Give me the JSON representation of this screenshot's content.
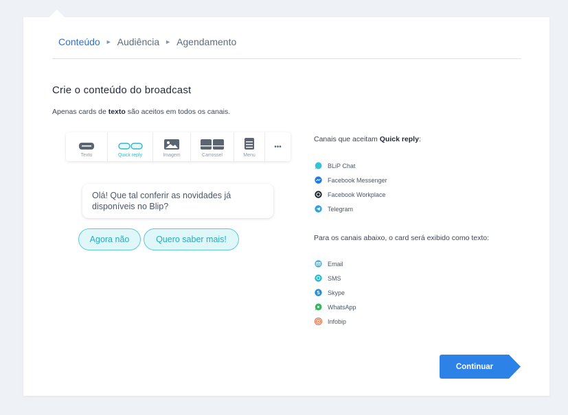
{
  "breadcrumb": {
    "steps": [
      "Conteúdo",
      "Audiência",
      "Agendamento"
    ]
  },
  "content": {
    "title": "Crie o conteúdo do broadcast",
    "subtitle_prefix": "Apenas cards de ",
    "subtitle_bold": "texto",
    "subtitle_suffix": " são aceitos em todos os canais."
  },
  "toolbar": {
    "items": [
      {
        "label": "Texto",
        "icon": "text-card-icon"
      },
      {
        "label": "Quick reply",
        "icon": "quick-reply-icon",
        "selected": true
      },
      {
        "label": "Imagem",
        "icon": "image-icon"
      },
      {
        "label": "Carrossel",
        "icon": "carousel-icon"
      },
      {
        "label": "Menu",
        "icon": "menu-card-icon"
      }
    ],
    "more": "•••"
  },
  "preview": {
    "message": "Olá! Que tal conferir as novidades já disponíveis no Blip?",
    "replies": [
      "Agora não",
      "Quero saber mais!"
    ]
  },
  "quick_reply_channels": {
    "heading_prefix": "Canais que aceitam ",
    "heading_bold": "Quick reply",
    "heading_suffix": ":",
    "items": [
      "BLiP Chat",
      "Facebook Messenger",
      "Facebook Workplace",
      "Telegram"
    ]
  },
  "text_channels": {
    "heading": "Para os canais abaixo, o card será exibido como texto:",
    "items": [
      "Email",
      "SMS",
      "Skype",
      "WhatsApp",
      "Infobip"
    ]
  },
  "actions": {
    "continue_label": "Continuar"
  },
  "colors": {
    "accent": "#2d6fd6",
    "teal": "#34b6c9",
    "button": "#2d82e8"
  }
}
